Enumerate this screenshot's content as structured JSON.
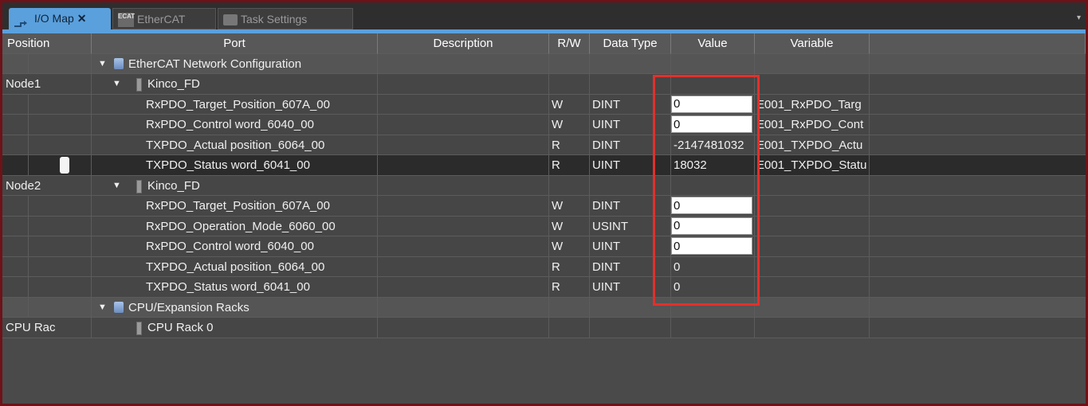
{
  "tabs": [
    {
      "label": "I/O Map",
      "icon": "io-map-icon"
    },
    {
      "label": "EtherCAT",
      "icon": "ethercat-icon",
      "icon_text": "ECAT"
    },
    {
      "label": "Task Settings",
      "icon": "task-settings-icon"
    }
  ],
  "tab_close": "✕",
  "tab_menu": "▾",
  "columns": {
    "position": "Position",
    "port": "Port",
    "description": "Description",
    "rw": "R/W",
    "data_type": "Data Type",
    "value": "Value",
    "variable": "Variable"
  },
  "tree_expanded_glyph": "▼",
  "rows": {
    "ethercat_group": "EtherCAT Network Configuration",
    "node1": {
      "position": "Node1",
      "device": "Kinco_FD"
    },
    "n1r1": {
      "port": "RxPDO_Target_Position_607A_00",
      "rw": "W",
      "type": "DINT",
      "value": "0",
      "variable": "E001_RxPDO_Targ"
    },
    "n1r2": {
      "port": "RxPDO_Control word_6040_00",
      "rw": "W",
      "type": "UINT",
      "value": "0",
      "variable": "E001_RxPDO_Cont"
    },
    "n1r3": {
      "port": "TXPDO_Actual position_6064_00",
      "rw": "R",
      "type": "DINT",
      "value": "-2147481032",
      "variable": "E001_TXPDO_Actu"
    },
    "n1r4": {
      "port": "TXPDO_Status word_6041_00",
      "rw": "R",
      "type": "UINT",
      "value": "18032",
      "variable": "E001_TXPDO_Statu"
    },
    "node2": {
      "position": "Node2",
      "device": "Kinco_FD"
    },
    "n2r1": {
      "port": "RxPDO_Target_Position_607A_00",
      "rw": "W",
      "type": "DINT",
      "value": "0"
    },
    "n2r2": {
      "port": "RxPDO_Operation_Mode_6060_00",
      "rw": "W",
      "type": "USINT",
      "value": "0"
    },
    "n2r3": {
      "port": "RxPDO_Control word_6040_00",
      "rw": "W",
      "type": "UINT",
      "value": "0"
    },
    "n2r4": {
      "port": "TXPDO_Actual position_6064_00",
      "rw": "R",
      "type": "DINT",
      "value": "0"
    },
    "n2r5": {
      "port": "TXPDO_Status word_6041_00",
      "rw": "R",
      "type": "UINT",
      "value": "0"
    },
    "cpu_group": "CPU/Expansion Racks",
    "cpu_rack": {
      "position": "CPU Rac",
      "port": "CPU Rack 0"
    }
  },
  "colors": {
    "tab_active": "#5aa0dc",
    "frame_border": "#6e1218",
    "highlight": "#e2302c",
    "grid_bg": "#464646",
    "selected_row_bg": "#2b2b2b"
  }
}
